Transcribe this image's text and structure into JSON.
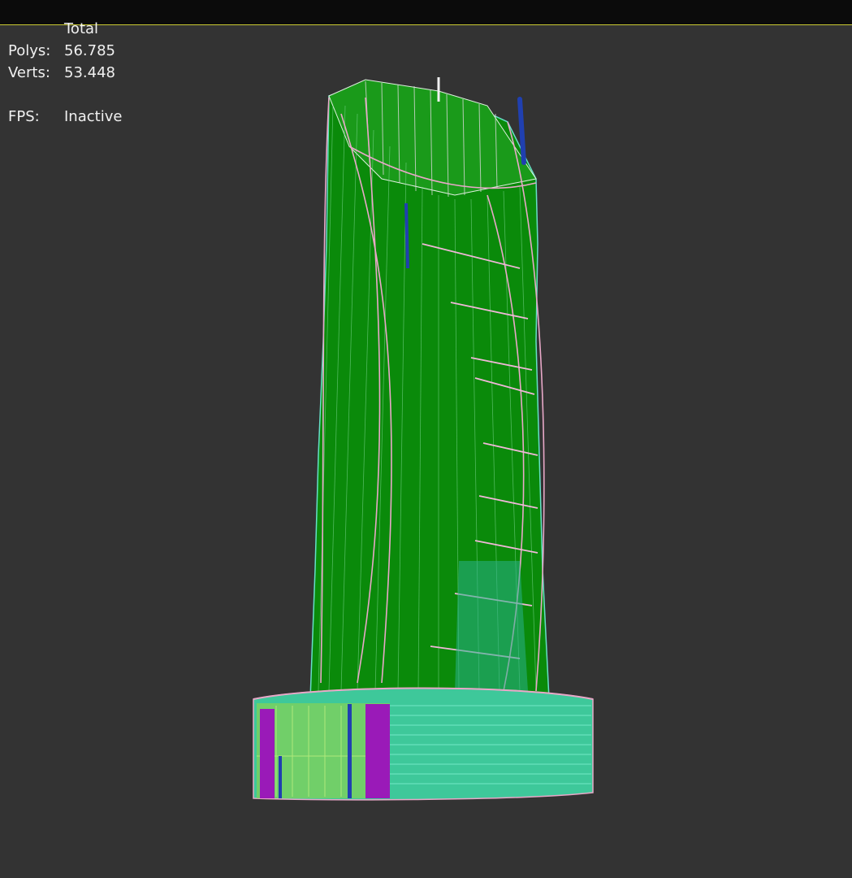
{
  "stats": {
    "header": "Total",
    "polys_label": "Polys:",
    "polys_value": "56.785",
    "verts_label": "Verts:",
    "verts_value": "53.448",
    "fps_label": "FPS:",
    "fps_value": "Inactive"
  },
  "colors": {
    "background": "#333333",
    "topbar": "#0b0b0b",
    "topbar_line": "#c8c832",
    "tower_green": "#0a8a0a",
    "wire_pink": "#e8a8c8",
    "wire_cyan": "#66e0c8",
    "wire_lime": "#a0e060",
    "podium_purple": "#9a1ab8",
    "mast_blue": "#2040b0"
  },
  "icons": [
    "tower-wireframe-model"
  ]
}
